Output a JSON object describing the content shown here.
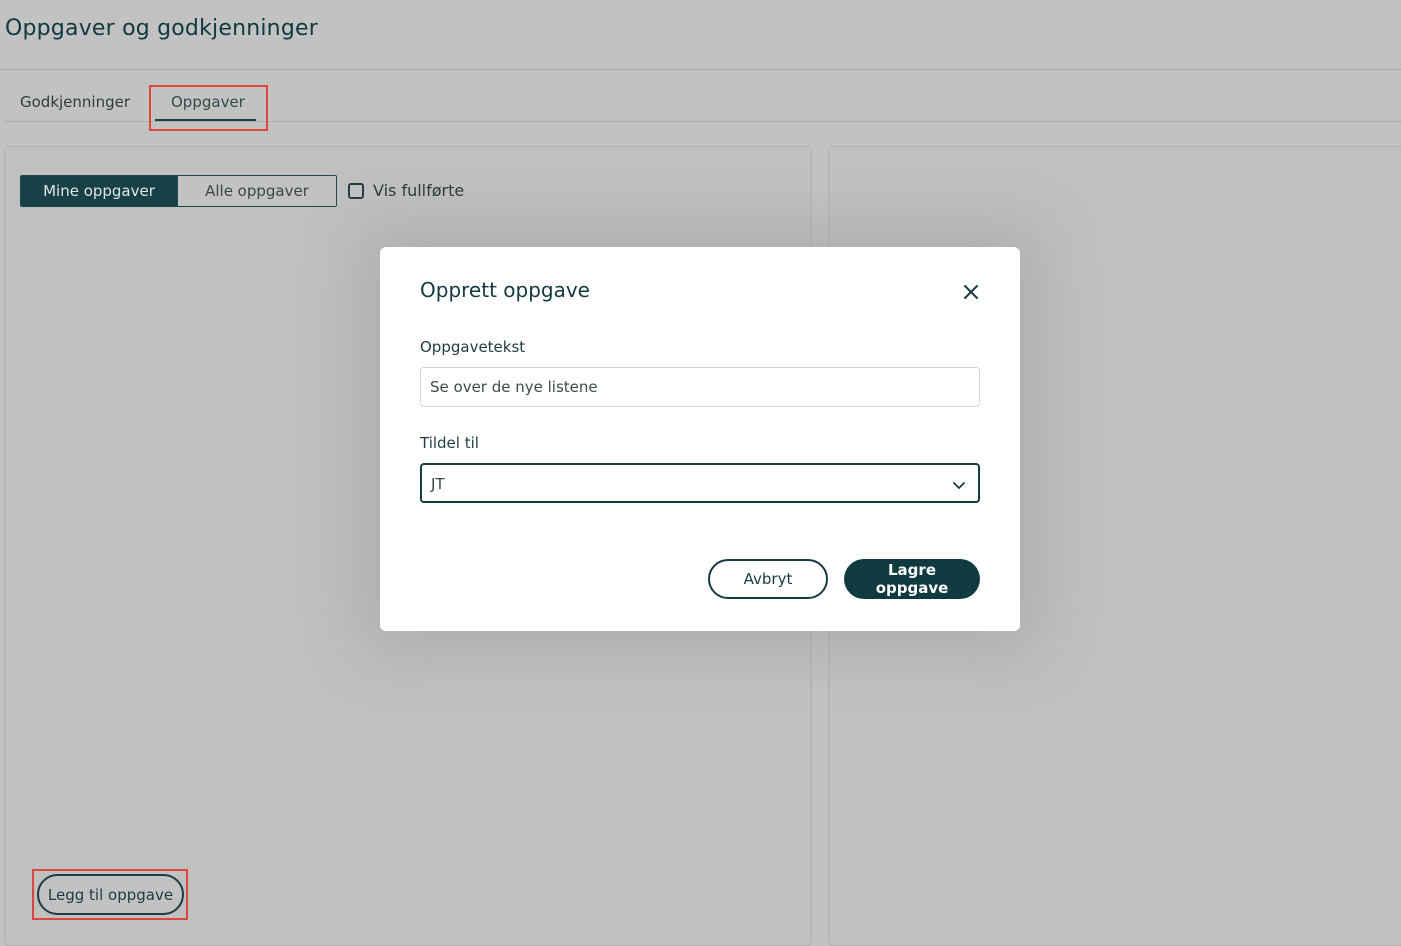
{
  "page": {
    "title": "Oppgaver og godkjenninger"
  },
  "tabs": [
    {
      "label": "Godkjenninger",
      "active": false
    },
    {
      "label": "Oppgaver",
      "active": true
    }
  ],
  "filters": {
    "mine_label": "Mine oppgaver",
    "all_label": "Alle oppgaver",
    "active": "Mine oppgaver",
    "show_completed_label": "Vis fullførte",
    "show_completed_checked": false
  },
  "actions": {
    "add_task_label": "Legg til oppgave"
  },
  "modal": {
    "title": "Opprett oppgave",
    "close_icon": "close-icon",
    "task_text_label": "Oppgavetekst",
    "task_text_value": "Se over de nye listene",
    "assign_label": "Tildel til",
    "assign_value": "JT",
    "cancel_label": "Avbryt",
    "save_label": "Lagre oppgave"
  },
  "colors": {
    "primary": "#0f3a3f",
    "highlight": "#e0443e",
    "backdrop": "#c2c2c2"
  }
}
